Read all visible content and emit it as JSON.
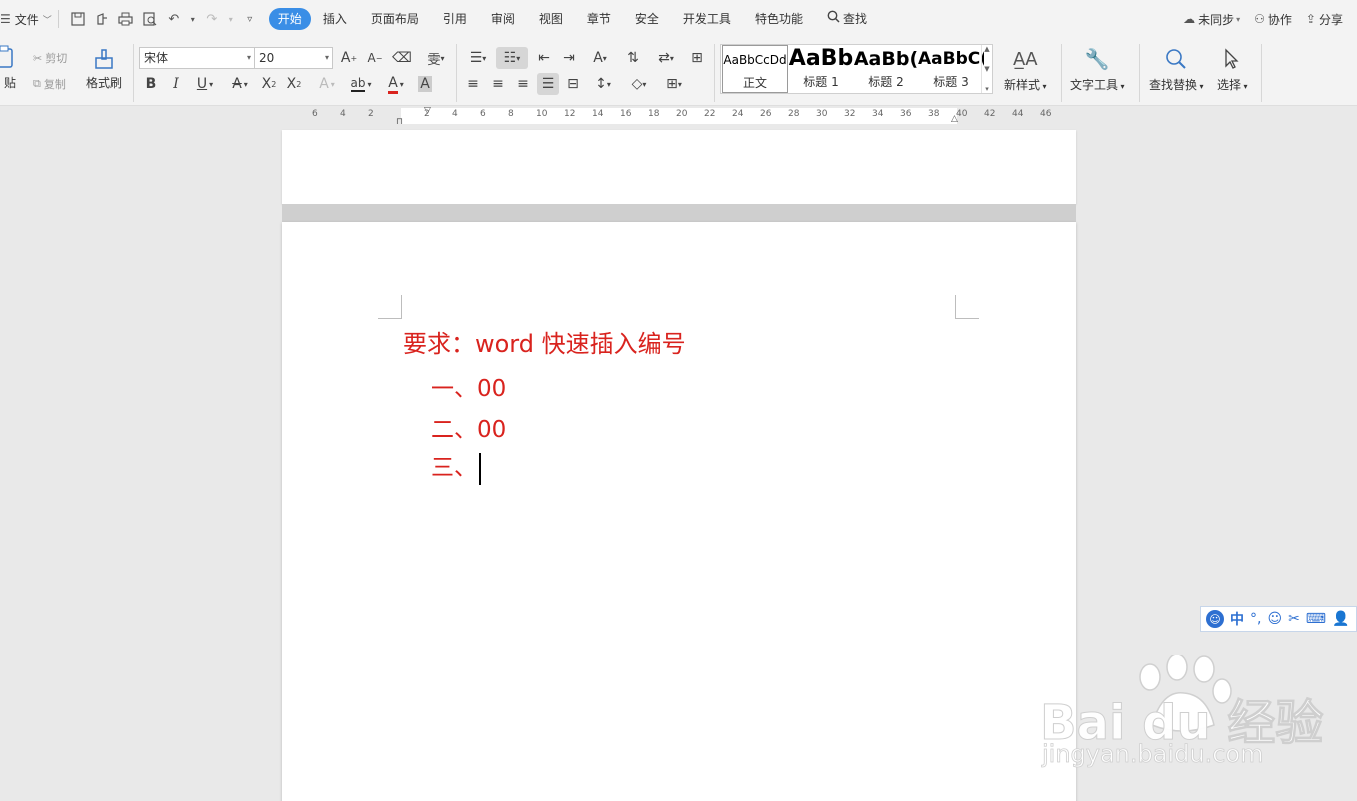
{
  "menubar": {
    "file_label": "文件",
    "tabs": [
      "开始",
      "插入",
      "页面布局",
      "引用",
      "审阅",
      "视图",
      "章节",
      "安全",
      "开发工具",
      "特色功能"
    ],
    "search_label": "查找",
    "sync_label": "未同步",
    "collab_label": "协作",
    "share_label": "分享"
  },
  "ribbon": {
    "paste_label": "贴",
    "cut_label": "剪切",
    "copy_label": "复制",
    "format_painter_label": "格式刷",
    "font_name": "宋体",
    "font_size": "20",
    "styles": [
      {
        "preview": "AaBbCcDd",
        "name": "正文"
      },
      {
        "preview": "AaBb",
        "name": "标题 1"
      },
      {
        "preview": "AaBb(",
        "name": "标题 2"
      },
      {
        "preview": "AaBbC(",
        "name": "标题 3"
      }
    ],
    "new_style_label": "新样式",
    "text_tools_label": "文字工具",
    "find_replace_label": "查找替换",
    "select_label": "选择"
  },
  "ruler": {
    "ticks": [
      "6",
      "4",
      "2",
      "",
      "2",
      "4",
      "6",
      "8",
      "10",
      "12",
      "14",
      "16",
      "18",
      "20",
      "22",
      "24",
      "26",
      "28",
      "30",
      "32",
      "34",
      "36",
      "38",
      "40",
      "42",
      "44",
      "46"
    ]
  },
  "document": {
    "title": "要求：word 快速插入编号",
    "items": [
      "一、00",
      "二、00",
      "三、"
    ]
  },
  "ime": {
    "mode": "中"
  },
  "watermark": {
    "brand": "Bai du 经验",
    "url": "jingyan.baidu.com"
  },
  "colors": {
    "accent": "#3a8ee6",
    "doc_text": "#d9231e"
  }
}
